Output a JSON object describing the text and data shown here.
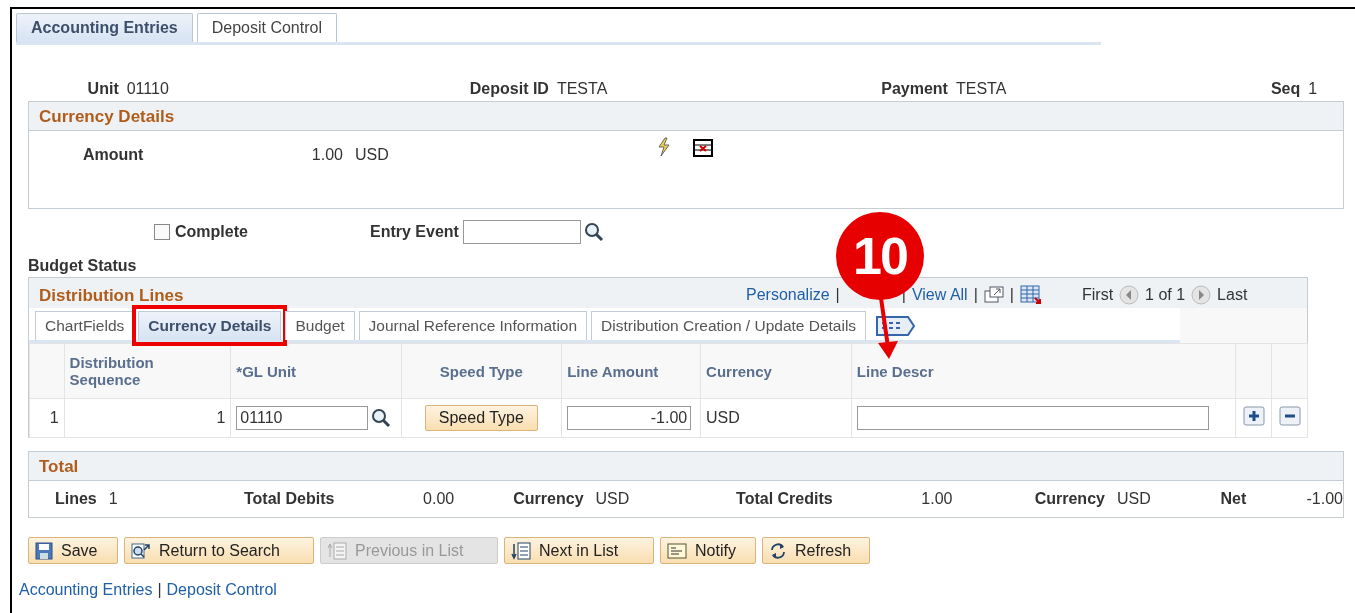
{
  "page_tabs": [
    {
      "label": "Accounting Entries",
      "selected": true
    },
    {
      "label": "Deposit Control",
      "selected": false
    }
  ],
  "header": [
    {
      "label": "Unit",
      "value": "01110"
    },
    {
      "label": "Deposit ID",
      "value": "TESTA"
    },
    {
      "label": "Payment",
      "value": "TESTA"
    },
    {
      "label": "Seq",
      "value": "1"
    }
  ],
  "currency_details": {
    "title": "Currency Details",
    "amount_label": "Amount",
    "amount": "1.00",
    "currency": "USD"
  },
  "complete": {
    "label": "Complete",
    "checked": false
  },
  "entry_event": {
    "label": "Entry Event"
  },
  "budget_status": {
    "label": "Budget Status"
  },
  "distribution_lines": {
    "title": "Distribution Lines",
    "personalize": "Personalize",
    "sep1": "|",
    "sep2": "|",
    "view_all": "View All",
    "sep3": "|",
    "sep4": "|",
    "first": "First",
    "count": "1 of 1",
    "last": "Last",
    "tabs": [
      {
        "label": "ChartFields",
        "selected": false
      },
      {
        "label": "Currency Details",
        "selected": true
      },
      {
        "label": "Budget",
        "selected": false
      },
      {
        "label": "Journal Reference Information",
        "selected": false
      },
      {
        "label": "Distribution Creation / Update Details",
        "selected": false
      }
    ],
    "columns": [
      "Distribution Sequence",
      "*GL Unit",
      "Speed Type",
      "Line Amount",
      "Currency",
      "Line Descr"
    ],
    "rows": [
      {
        "row": "1",
        "sequence": "1",
        "gl_unit": "01110",
        "speed_type": "Speed Type",
        "line_amount": "-1.00",
        "currency": "USD"
      }
    ]
  },
  "total": {
    "title": "Total",
    "items": [
      {
        "label": "Lines",
        "value": "1"
      },
      {
        "label": "Total Debits",
        "value": "0.00"
      },
      {
        "label": "Currency",
        "value": "USD"
      },
      {
        "label": "Total Credits",
        "value": "1.00"
      },
      {
        "label": "Currency",
        "value": "USD"
      },
      {
        "label": "Net",
        "value": "-1.00"
      }
    ]
  },
  "buttons": [
    {
      "label": "Save",
      "disabled": false
    },
    {
      "label": "Return to Search",
      "disabled": false
    },
    {
      "label": "Previous in List",
      "disabled": true
    },
    {
      "label": "Next in List",
      "disabled": false
    },
    {
      "label": "Notify",
      "disabled": false
    },
    {
      "label": "Refresh",
      "disabled": false
    }
  ],
  "footer_links": [
    {
      "label": "Accounting Entries"
    },
    {
      "label": "|"
    },
    {
      "label": "Deposit Control"
    }
  ],
  "callout": {
    "label": "10"
  }
}
